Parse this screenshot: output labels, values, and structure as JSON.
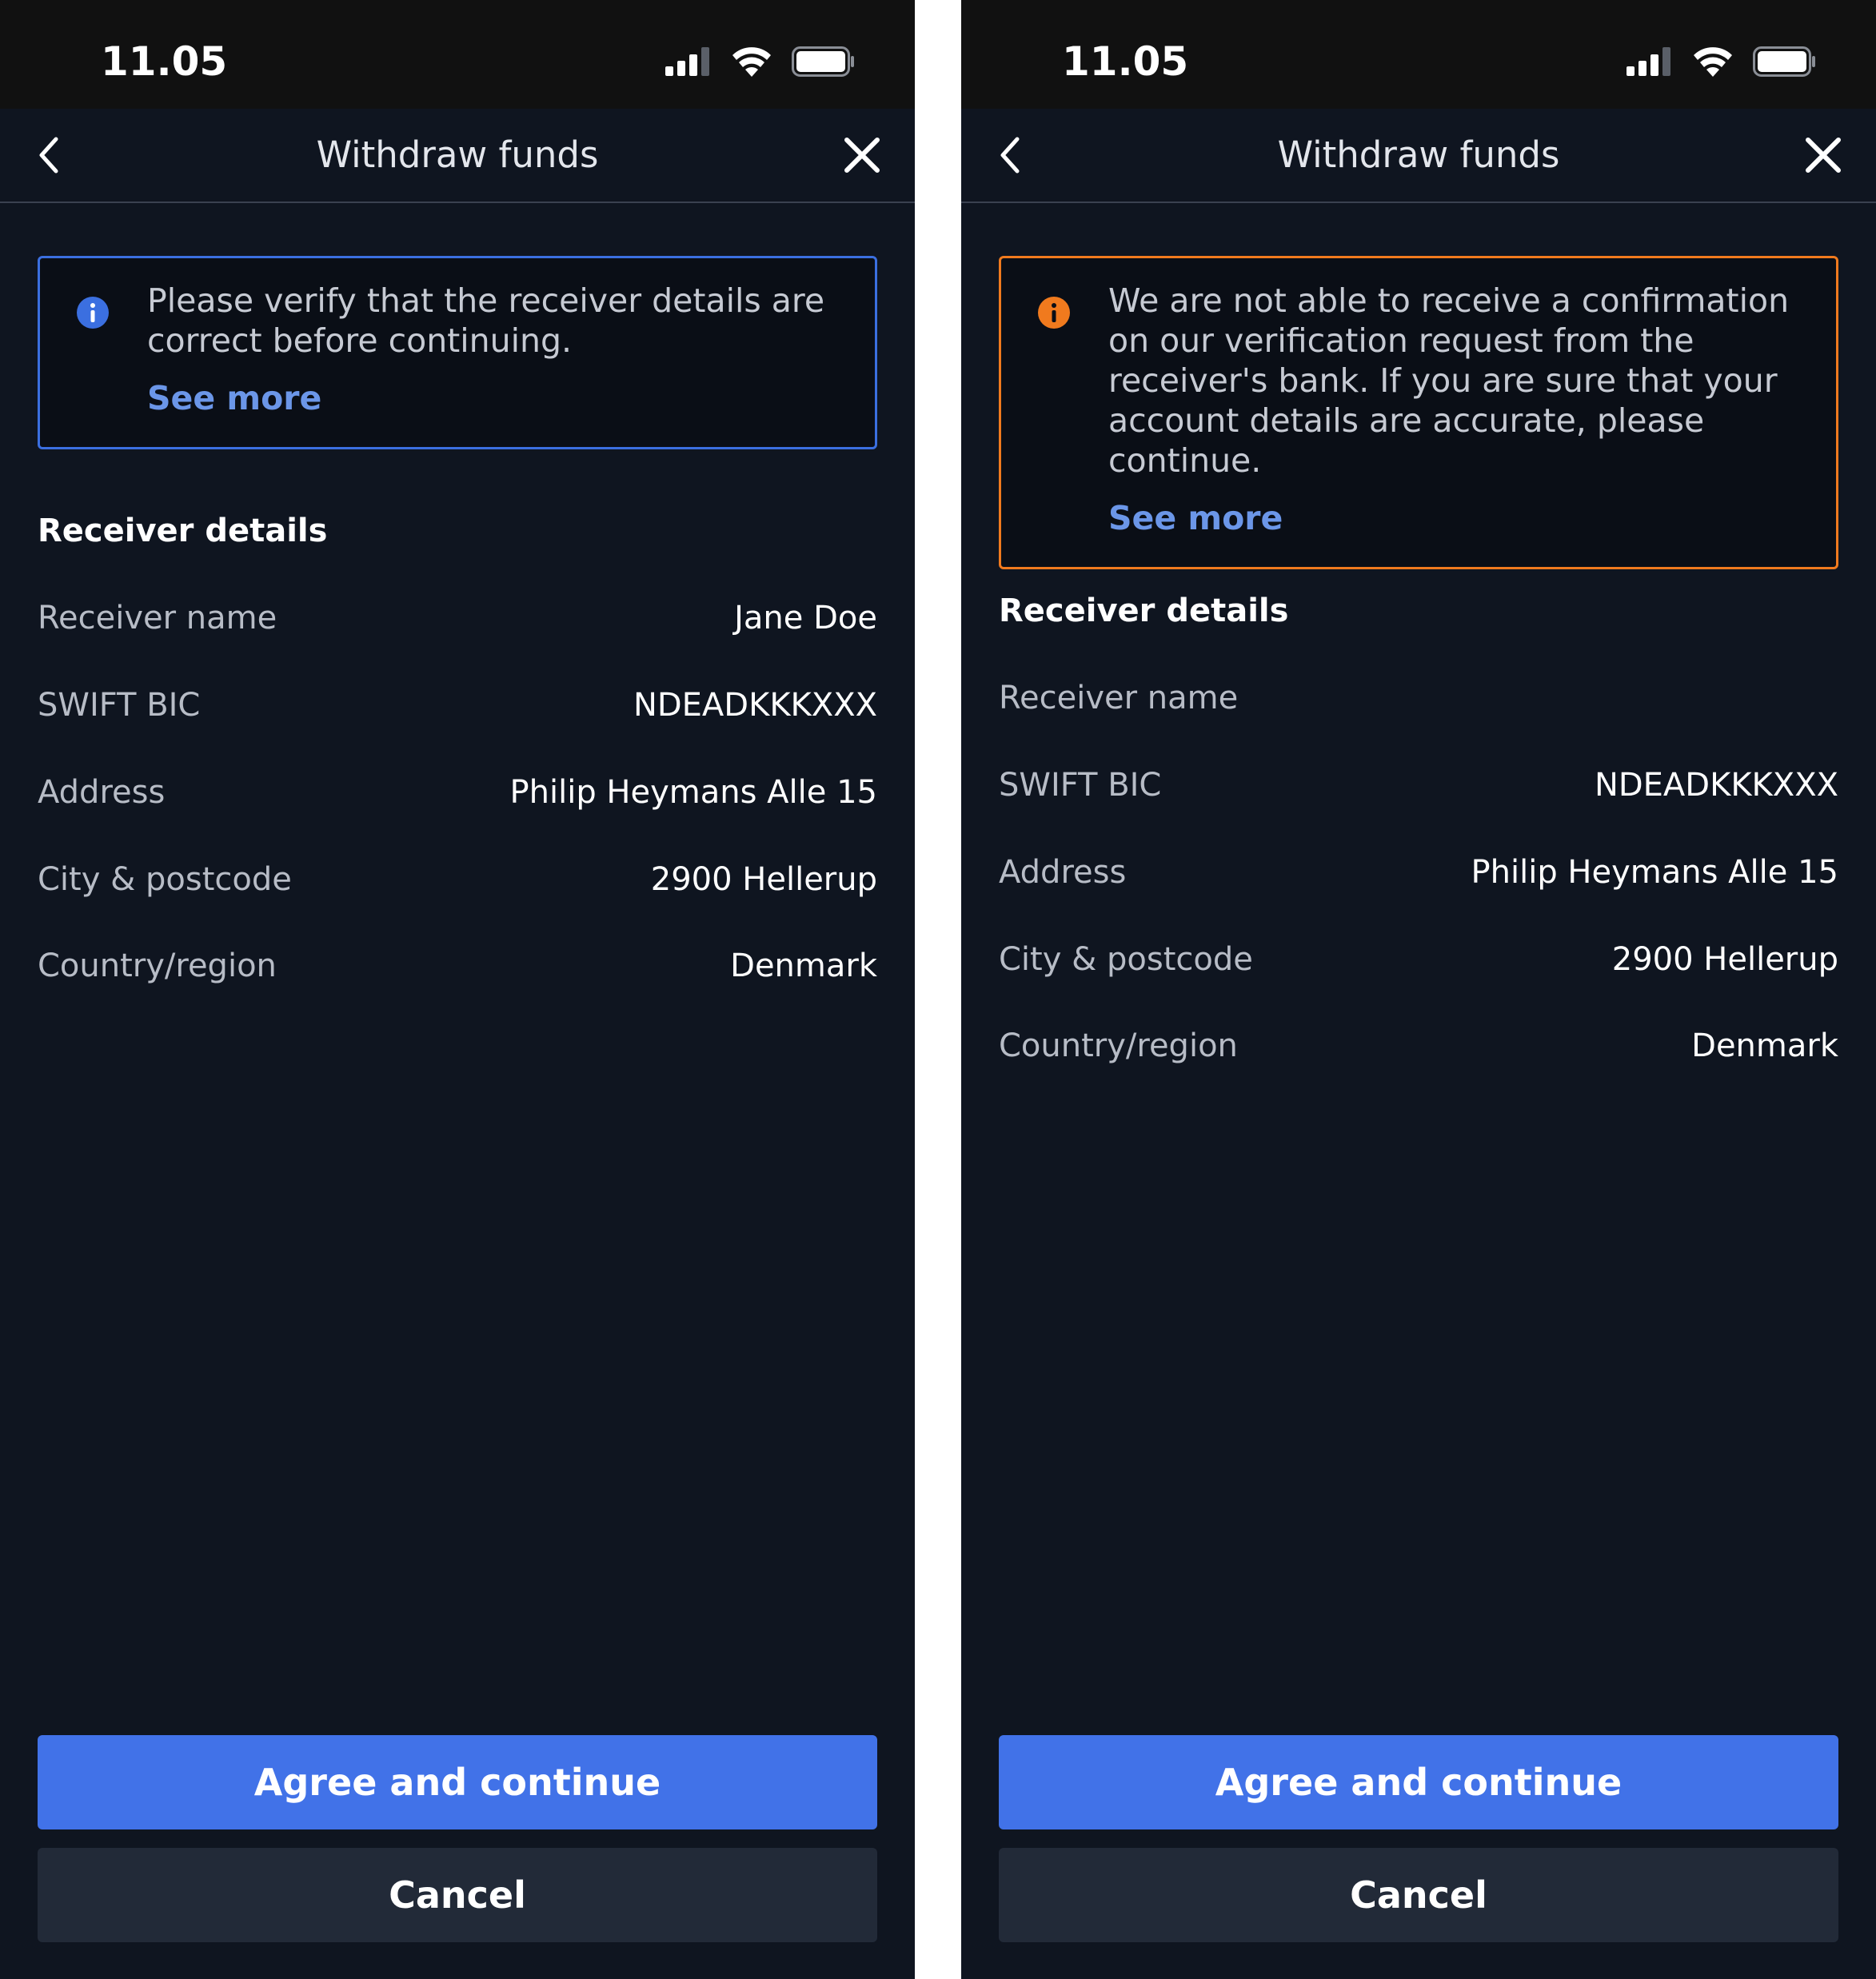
{
  "screens": [
    {
      "status": {
        "time": "11.05"
      },
      "header": {
        "title": "Withdraw funds"
      },
      "alert": {
        "type": "info",
        "message": "Please verify that the receiver details are correct before continuing.",
        "link_label": "See more"
      },
      "details": {
        "title": "Receiver details",
        "rows": [
          {
            "label": "Receiver name",
            "value": "Jane Doe"
          },
          {
            "label": "SWIFT BIC",
            "value": "NDEADKKKXXX"
          },
          {
            "label": "Address",
            "value": "Philip Heymans Alle 15"
          },
          {
            "label": "City & postcode",
            "value": "2900 Hellerup"
          },
          {
            "label": "Country/region",
            "value": "Denmark"
          }
        ]
      },
      "actions": {
        "primary_label": "Agree and continue",
        "secondary_label": "Cancel"
      }
    },
    {
      "status": {
        "time": "11.05"
      },
      "header": {
        "title": "Withdraw funds"
      },
      "alert": {
        "type": "warning",
        "message": "We are not able to receive a confirmation on our verification request from the receiver's bank. If you are sure that your account details are accurate, please continue.",
        "link_label": "See more"
      },
      "details": {
        "title": "Receiver details",
        "rows": [
          {
            "label": "Receiver name",
            "value": ""
          },
          {
            "label": "SWIFT BIC",
            "value": "NDEADKKKXXX"
          },
          {
            "label": "Address",
            "value": "Philip Heymans Alle 15"
          },
          {
            "label": "City & postcode",
            "value": "2900 Hellerup"
          },
          {
            "label": "Country/region",
            "value": "Denmark"
          }
        ]
      },
      "actions": {
        "primary_label": "Agree and continue",
        "secondary_label": "Cancel"
      }
    }
  ],
  "icons": {
    "signal": "cellular-signal-icon",
    "wifi": "wifi-icon",
    "battery": "battery-icon",
    "back": "chevron-left-icon",
    "close": "close-icon",
    "info": "info-icon",
    "warning": "warning-info-icon"
  },
  "colors": {
    "background": "#0f1520",
    "status_bar": "#111111",
    "info_accent": "#3b6fe0",
    "warning_accent": "#f07a1e",
    "link": "#6b96e8",
    "primary_button": "#4172e8",
    "secondary_button": "#222a38"
  }
}
